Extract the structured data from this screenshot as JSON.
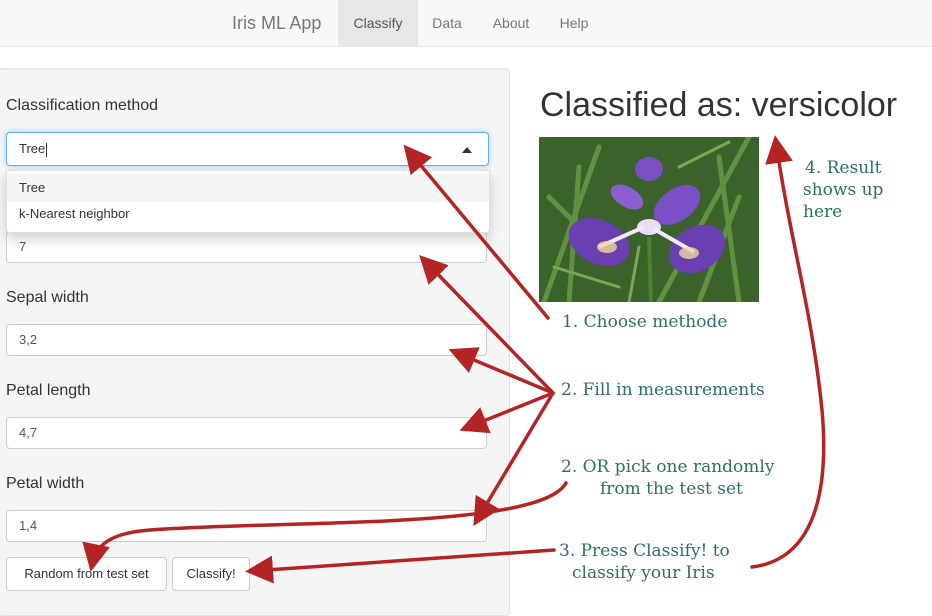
{
  "navbar": {
    "brand": "Iris ML App",
    "tabs": [
      {
        "label": "Classify",
        "active": true
      },
      {
        "label": "Data",
        "active": false
      },
      {
        "label": "About",
        "active": false
      },
      {
        "label": "Help",
        "active": false
      }
    ]
  },
  "sidebar": {
    "method": {
      "label": "Classification method",
      "value": "Tree",
      "options": [
        "Tree",
        "k-Nearest neighbor"
      ],
      "highlighted_option": "Tree"
    },
    "sepal_length": {
      "value": "7"
    },
    "sepal_width": {
      "label": "Sepal width",
      "value": "3,2"
    },
    "petal_length": {
      "label": "Petal length",
      "value": "4,7"
    },
    "petal_width": {
      "label": "Petal width",
      "value": "1,4"
    },
    "buttons": {
      "random": "Random from test set",
      "classify": "Classify!"
    }
  },
  "result": {
    "title": "Classified as: versicolor",
    "image": "iris-versicolor-flower-photo"
  },
  "annotations": {
    "step1": "1. Choose methode",
    "step2": "2. Fill in measurements",
    "step2b_line1": "2. OR pick one randomly",
    "step2b_line2": "from the test set",
    "step3_line1": "3. Press Classify! to",
    "step3_line2": "classify your Iris",
    "step4_line1": "4. Result",
    "step4_line2": "shows up",
    "step4_line3": "here"
  },
  "colors": {
    "navbar_bg": "#f8f8f8",
    "active_tab_bg": "#e7e7e7",
    "arrow_red": "#b52424",
    "annotation_text": "#2e6e6a",
    "focus_border": "#66afe9"
  }
}
